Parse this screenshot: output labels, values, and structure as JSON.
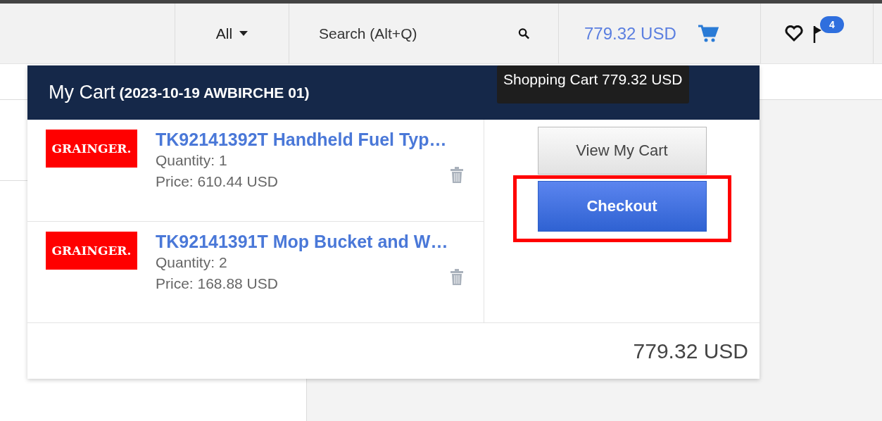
{
  "header": {
    "scope": "All",
    "search": {
      "placeholder": "Search (Alt+Q)"
    },
    "cart_total": "779.32 USD",
    "notifications_badge": "4"
  },
  "tooltip": "Shopping Cart 779.32 USD",
  "cart": {
    "title": "My Cart",
    "subtitle": "(2023-10-19 AWBIRCHE 01)",
    "items": [
      {
        "logo": "GRAINGER.",
        "name": "TK92141392T Handheld Fuel Typ…",
        "quantity": "Quantity: 1",
        "price": "Price: 610.44 USD"
      },
      {
        "logo": "GRAINGER.",
        "name": "TK92141391T Mop Bucket and W…",
        "quantity": "Quantity: 2",
        "price": "Price: 168.88 USD"
      }
    ],
    "view_button": "View My Cart",
    "checkout": {
      "label": "Checkout",
      "highlighted": true
    },
    "total": "779.32 USD"
  }
}
